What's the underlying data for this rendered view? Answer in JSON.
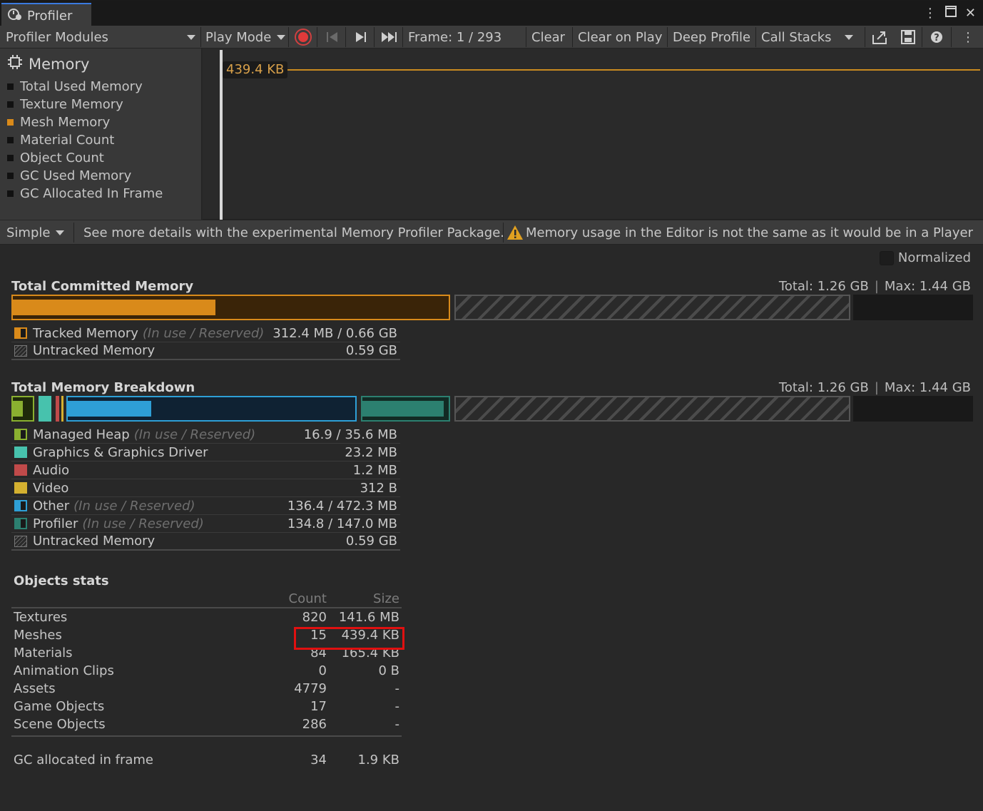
{
  "window": {
    "tab_title": "Profiler"
  },
  "toolbar": {
    "modules_label": "Profiler Modules",
    "play_mode_label": "Play Mode",
    "frame_label": "Frame: 1 / 293",
    "clear_label": "Clear",
    "clear_on_play_label": "Clear on Play",
    "deep_profile_label": "Deep Profile",
    "call_stacks_label": "Call Stacks"
  },
  "module": {
    "title": "Memory",
    "items": [
      {
        "label": "Total Used Memory",
        "color": "#111111"
      },
      {
        "label": "Texture Memory",
        "color": "#111111"
      },
      {
        "label": "Mesh Memory",
        "color": "#d98a1a"
      },
      {
        "label": "Material Count",
        "color": "#111111"
      },
      {
        "label": "Object Count",
        "color": "#111111"
      },
      {
        "label": "GC Used Memory",
        "color": "#111111"
      },
      {
        "label": "GC Allocated In Frame",
        "color": "#111111"
      }
    ]
  },
  "chart": {
    "value_label": "439.4 KB",
    "line_color": "#c98a20"
  },
  "infobar": {
    "view_mode": "Simple",
    "details_text": "See more details with the experimental Memory Profiler Package.",
    "warning_text": "Memory usage in the Editor is not the same as it would be in a Player"
  },
  "normalized_label": "Normalized",
  "committed": {
    "title": "Total Committed Memory",
    "total": "Total: 1.26 GB",
    "max": "Max: 1.44 GB",
    "tracked_fill_fraction": 0.465,
    "legend": [
      {
        "label": "Tracked Memory",
        "note": "(In use / Reserved)",
        "value": "312.4 MB / 0.66 GB",
        "color": "#d98a1a"
      },
      {
        "label": "Untracked Memory",
        "note": "",
        "value": "0.59 GB",
        "color": "#3a3a3a"
      }
    ]
  },
  "breakdown": {
    "title": "Total Memory Breakdown",
    "total": "Total: 1.26 GB",
    "max": "Max: 1.44 GB",
    "legend": [
      {
        "label": "Managed Heap",
        "note": "(In use / Reserved)",
        "value": "16.9 / 35.6 MB",
        "color": "#8ab030"
      },
      {
        "label": "Graphics & Graphics Driver",
        "note": "",
        "value": "23.2 MB",
        "color": "#47c2ad"
      },
      {
        "label": "Audio",
        "note": "",
        "value": "1.2 MB",
        "color": "#c04a4a"
      },
      {
        "label": "Video",
        "note": "",
        "value": "312 B",
        "color": "#d4b030"
      },
      {
        "label": "Other",
        "note": "(In use / Reserved)",
        "value": "136.4 / 472.3 MB",
        "color": "#2e9fd6"
      },
      {
        "label": "Profiler",
        "note": "(In use / Reserved)",
        "value": "134.8 / 147.0 MB",
        "color": "#2c8070"
      },
      {
        "label": "Untracked Memory",
        "note": "",
        "value": "0.59 GB",
        "color": "#3a3a3a"
      }
    ]
  },
  "objects_stats": {
    "title": "Objects stats",
    "count_header": "Count",
    "size_header": "Size",
    "rows": [
      {
        "name": "Textures",
        "count": "820",
        "size": "141.6 MB"
      },
      {
        "name": "Meshes",
        "count": "15",
        "size": "439.4 KB"
      },
      {
        "name": "Materials",
        "count": "84",
        "size": "165.4 KB"
      },
      {
        "name": "Animation Clips",
        "count": "0",
        "size": "0 B"
      },
      {
        "name": "Assets",
        "count": "4779",
        "size": "-"
      },
      {
        "name": "Game Objects",
        "count": "17",
        "size": "-"
      },
      {
        "name": "Scene Objects",
        "count": "286",
        "size": "-"
      }
    ],
    "gc": {
      "name": "GC allocated in frame",
      "count": "34",
      "size": "1.9 KB"
    }
  }
}
